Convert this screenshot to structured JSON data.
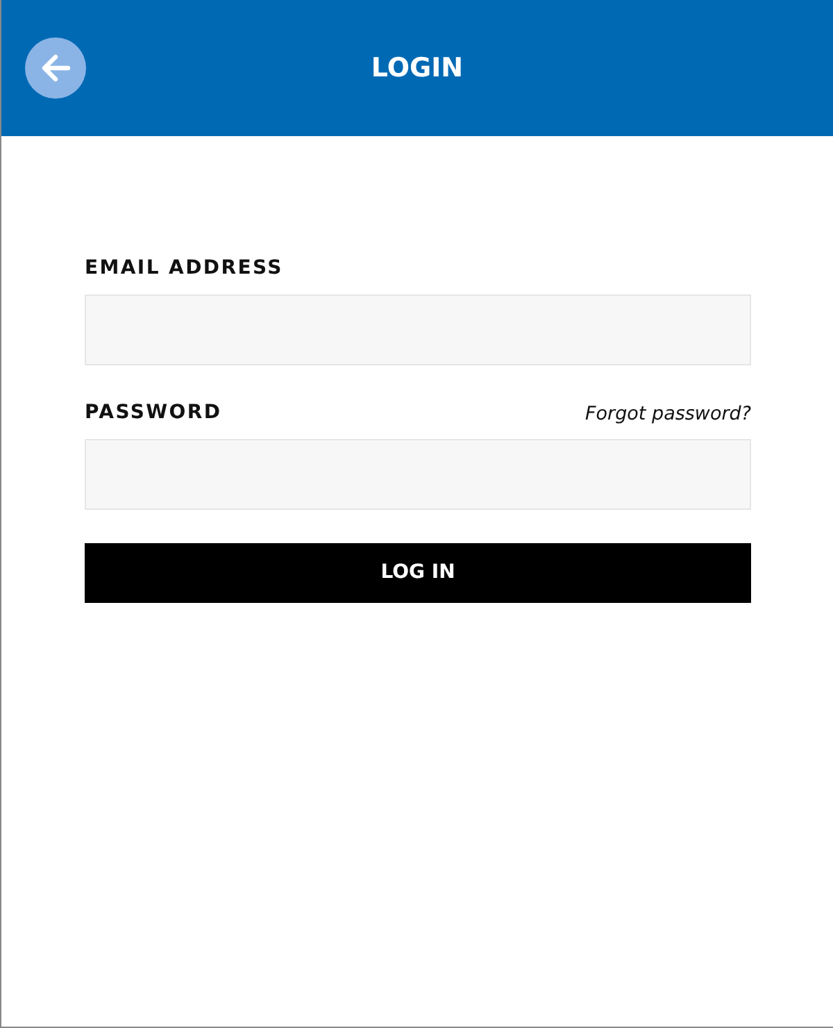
{
  "header": {
    "title": "LOGIN"
  },
  "form": {
    "fields": [
      {
        "label": "EMAIL ADDRESS"
      },
      {
        "label": "PASSWORD",
        "link": "Forgot password?"
      }
    ],
    "submit": "LOG IN"
  }
}
